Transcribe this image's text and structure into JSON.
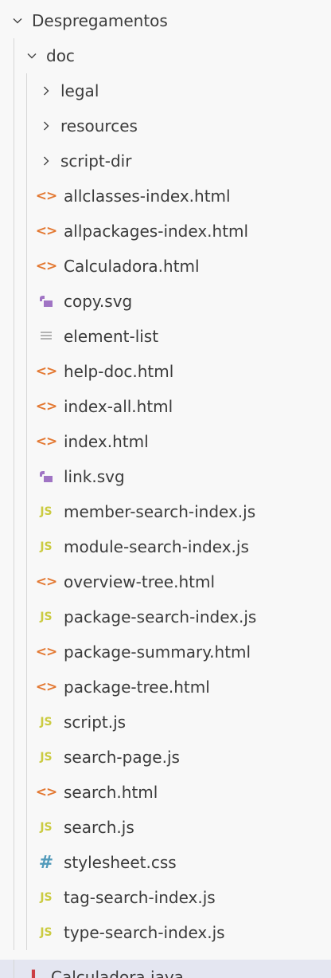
{
  "explorer": {
    "root": {
      "label": "Despregamentos",
      "expanded": true
    },
    "doc": {
      "label": "doc",
      "expanded": true
    },
    "folders": [
      {
        "label": "legal"
      },
      {
        "label": "resources"
      },
      {
        "label": "script-dir"
      }
    ],
    "files": [
      {
        "label": "allclasses-index.html",
        "type": "html"
      },
      {
        "label": "allpackages-index.html",
        "type": "html"
      },
      {
        "label": "Calculadora.html",
        "type": "html"
      },
      {
        "label": "copy.svg",
        "type": "svg"
      },
      {
        "label": "element-list",
        "type": "txt"
      },
      {
        "label": "help-doc.html",
        "type": "html"
      },
      {
        "label": "index-all.html",
        "type": "html"
      },
      {
        "label": "index.html",
        "type": "html"
      },
      {
        "label": "link.svg",
        "type": "svg"
      },
      {
        "label": "member-search-index.js",
        "type": "js"
      },
      {
        "label": "module-search-index.js",
        "type": "js"
      },
      {
        "label": "overview-tree.html",
        "type": "html"
      },
      {
        "label": "package-search-index.js",
        "type": "js"
      },
      {
        "label": "package-summary.html",
        "type": "html"
      },
      {
        "label": "package-tree.html",
        "type": "html"
      },
      {
        "label": "script.js",
        "type": "js"
      },
      {
        "label": "search-page.js",
        "type": "js"
      },
      {
        "label": "search.html",
        "type": "html"
      },
      {
        "label": "search.js",
        "type": "js"
      },
      {
        "label": "stylesheet.css",
        "type": "css"
      },
      {
        "label": "tag-search-index.js",
        "type": "js"
      },
      {
        "label": "type-search-index.js",
        "type": "js"
      }
    ],
    "sibling": {
      "label": "Calculadora.java",
      "type": "java",
      "selected": true
    },
    "icon_glyphs": {
      "html": "<>",
      "js": "JS",
      "css": "#",
      "java": "J"
    },
    "colors": {
      "html": "#e37933",
      "js": "#cbcb41",
      "css": "#519aba",
      "svg": "#a074c4",
      "java": "#cc3e44",
      "selection": "#e4e6f1"
    }
  }
}
